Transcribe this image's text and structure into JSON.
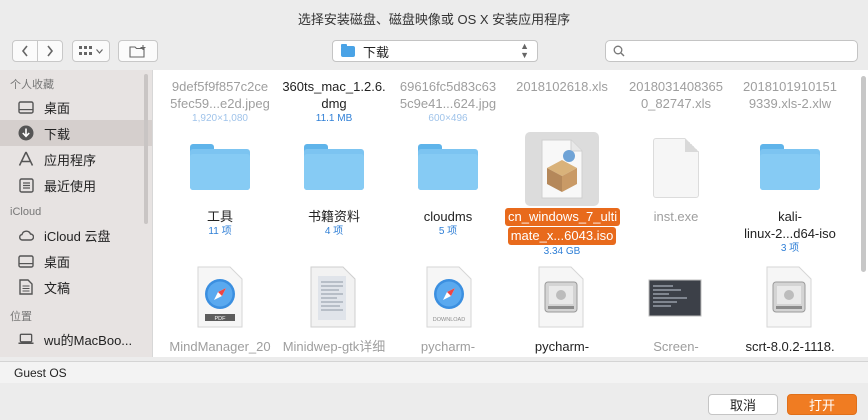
{
  "window": {
    "title": "选择安装磁盘、磁盘映像或 OS X 安装应用程序"
  },
  "toolbar": {
    "location": "下载",
    "search_placeholder": "",
    "icons": {
      "back": "chevron-left-icon",
      "forward": "chevron-right-icon",
      "view": "grid-view-icon",
      "new_folder": "new-folder-icon",
      "search": "search-icon"
    }
  },
  "sidebar": {
    "favorites_title": "个人收藏",
    "favorites": [
      {
        "label": "桌面",
        "icon": "desktop-icon"
      },
      {
        "label": "下载",
        "icon": "downloads-icon",
        "selected": true
      },
      {
        "label": "应用程序",
        "icon": "applications-icon"
      },
      {
        "label": "最近使用",
        "icon": "recents-icon"
      }
    ],
    "icloud_title": "iCloud",
    "icloud": [
      {
        "label": "iCloud 云盘",
        "icon": "cloud-icon"
      },
      {
        "label": "桌面",
        "icon": "desktop-icon"
      },
      {
        "label": "文稿",
        "icon": "documents-icon"
      }
    ],
    "locations_title": "位置",
    "locations": [
      {
        "label": "wu的MacBoo...",
        "icon": "laptop-icon"
      }
    ]
  },
  "files": {
    "row1": [
      {
        "name1": "9def5f9f857c2ce",
        "name2": "5fec59...e2d.jpeg",
        "sub": "1,920×1,080",
        "dim": true
      },
      {
        "name1": "360ts_mac_1.2.6.",
        "name2": "dmg",
        "sub": "11.1 MB",
        "dim": false
      },
      {
        "name1": "69616fc5d83c63",
        "name2": "5c9e41...624.jpg",
        "sub": "600×496",
        "dim": true
      },
      {
        "name1": "2018102618.xls",
        "name2": "",
        "sub": "",
        "dim": true
      },
      {
        "name1": "2018031408365",
        "name2": "0_82747.xls",
        "sub": "",
        "dim": true
      },
      {
        "name1": "2018101910151",
        "name2": "9339.xls-2.xlw",
        "sub": "",
        "dim": true
      }
    ],
    "row2": [
      {
        "name1": "工具",
        "name2": "",
        "sub": "11 项",
        "dim": false
      },
      {
        "name1": "书籍资料",
        "name2": "",
        "sub": "4 项",
        "dim": false
      },
      {
        "name1": "cloudms",
        "name2": "",
        "sub": "5 项",
        "dim": false
      },
      {
        "name1": "cn_windows_7_ulti",
        "name2": "mate_x...6043.iso",
        "sub": "3.34 GB",
        "dim": false,
        "selected": true
      },
      {
        "name1": "inst.exe",
        "name2": "",
        "sub": "",
        "dim": true
      },
      {
        "name1": "kali-",
        "name2": "linux-2...d64-iso",
        "sub": "3 项",
        "dim": false
      }
    ],
    "row3": [
      {
        "name1": "MindManager_20",
        "dim": true
      },
      {
        "name1": "Minidwep-gtk详细",
        "dim": true
      },
      {
        "name1": "pycharm-",
        "dim": true
      },
      {
        "name1": "pycharm-",
        "dim": false
      },
      {
        "name1": "Screen-",
        "dim": true
      },
      {
        "name1": "scrt-8.0.2-1118.",
        "dim": false
      }
    ],
    "row3_icon_labels": {
      "mindmanager": "PDF",
      "pycharm": "DOWNLOAD"
    }
  },
  "status": {
    "text": "Guest OS"
  },
  "buttons": {
    "cancel": "取消",
    "open": "打开"
  },
  "colors": {
    "accent": "#f07c22",
    "folder": "#7cc4f1",
    "selection": "#e86a1c",
    "link": "#2f7fd6"
  }
}
